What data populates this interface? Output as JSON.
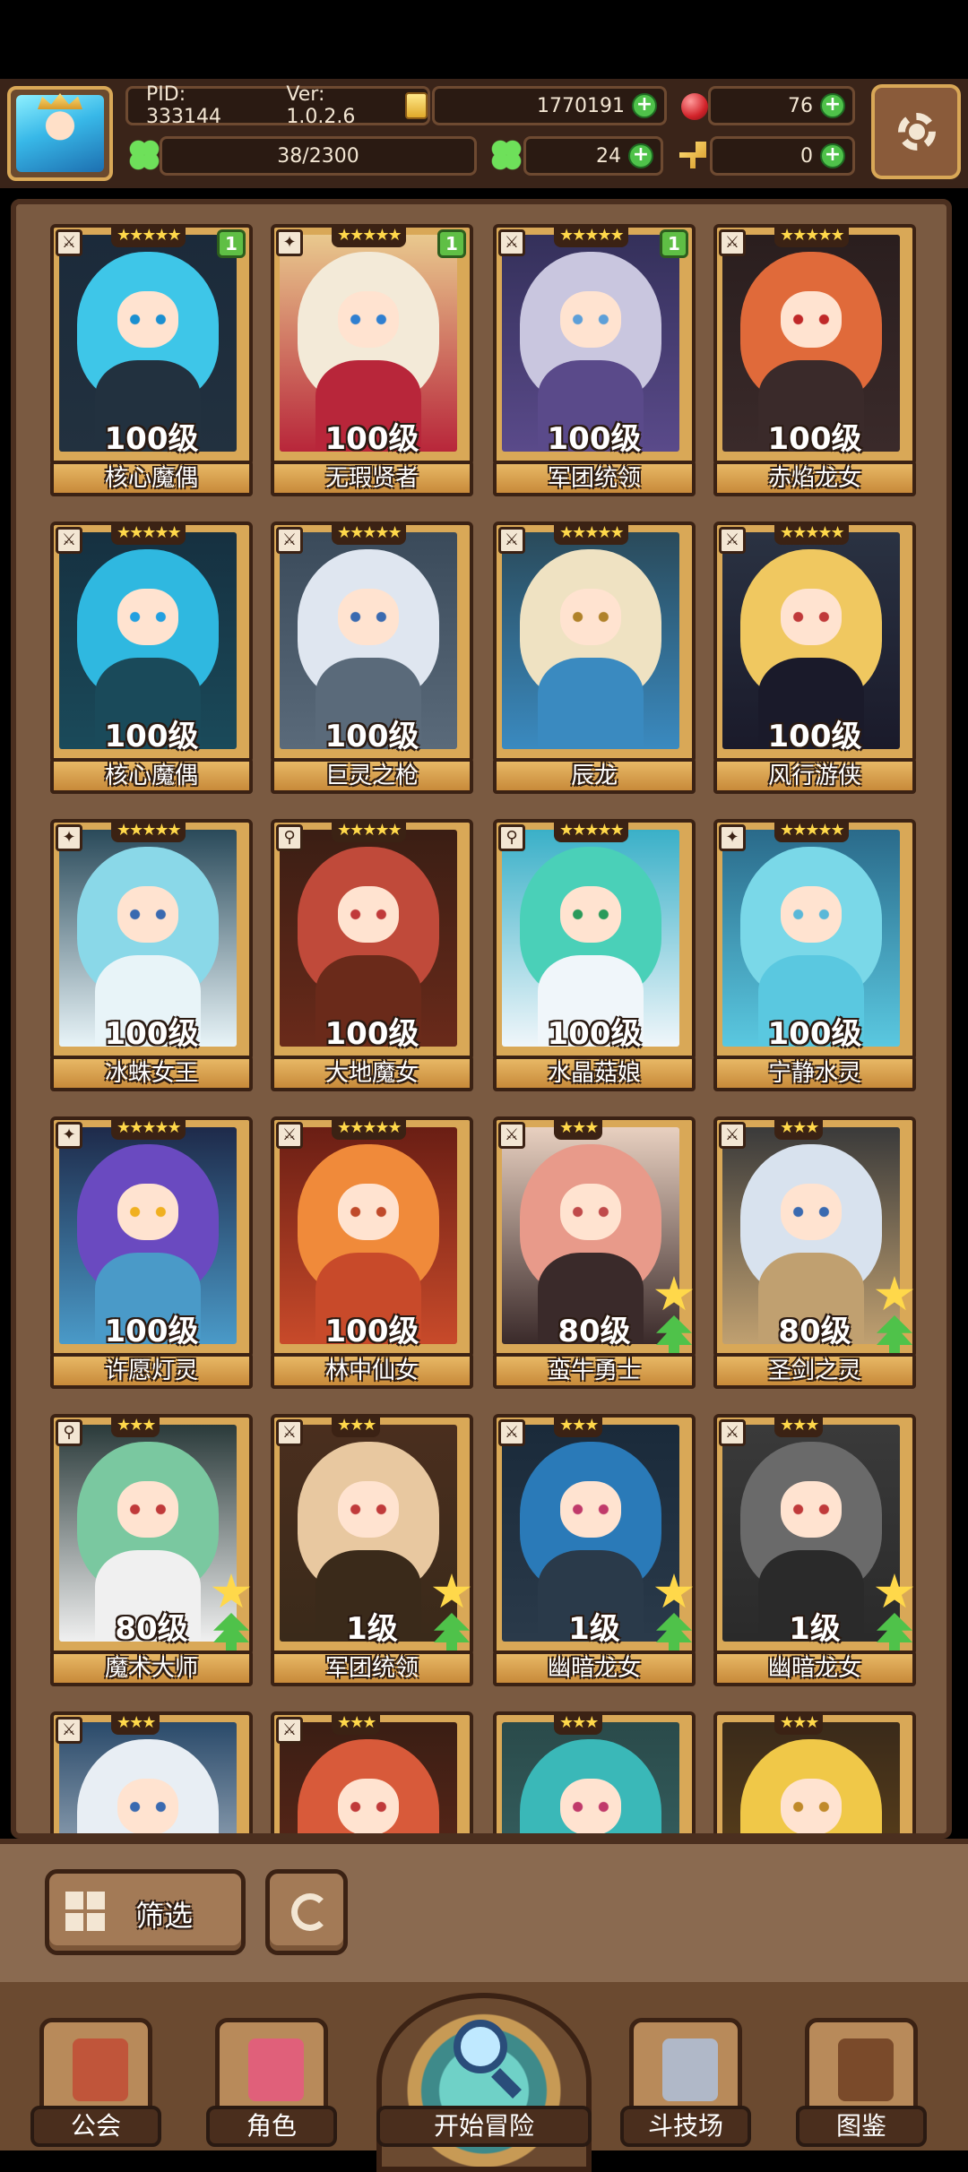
{
  "hud": {
    "pid": "PID: 333144",
    "version": "Ver: 1.0.2.6",
    "gold": "1770191",
    "gems": "76",
    "exp": "38/2300",
    "clover": "24",
    "keys": "0",
    "accent": "#d9a857"
  },
  "roster": [
    {
      "level": "100级",
      "name": "核心魔偶",
      "stars": "★★★★★",
      "class_icon": "⚔",
      "dupe": "1",
      "hair": "#3ec6e8",
      "eye": "#1a8fd0",
      "body": "#22313f",
      "bg": "#1b2a3a"
    },
    {
      "level": "100级",
      "name": "无瑕贤者",
      "stars": "★★★★★",
      "class_icon": "✦",
      "dupe": "1",
      "hair": "#f3ead8",
      "eye": "#2f7fd0",
      "body": "#b8263a",
      "bg": "#e9c98e"
    },
    {
      "level": "100级",
      "name": "军团统领",
      "stars": "★★★★★",
      "class_icon": "⚔",
      "dupe": "1",
      "hair": "#c9c6df",
      "eye": "#5d9fd8",
      "body": "#5a4a8a",
      "bg": "#34305a"
    },
    {
      "level": "100级",
      "name": "赤焰龙女",
      "stars": "★★★★★",
      "class_icon": "⚔",
      "dupe": "",
      "hair": "#e06a3a",
      "eye": "#c02828",
      "body": "#3a2a2a",
      "bg": "#2a1e1e"
    },
    {
      "level": "100级",
      "name": "核心魔偶",
      "stars": "★★★★★",
      "class_icon": "⚔",
      "dupe": "",
      "hair": "#2fb8e0",
      "eye": "#22a0e0",
      "body": "#1a4a5a",
      "bg": "#163040"
    },
    {
      "level": "100级",
      "name": "巨灵之枪",
      "stars": "★★★★★",
      "class_icon": "⚔",
      "dupe": "",
      "hair": "#dfe6f0",
      "eye": "#3a6ab0",
      "body": "#5a6a7a",
      "bg": "#3a4a5a"
    },
    {
      "level": "",
      "name": "辰龙",
      "stars": "★★★★★",
      "class_icon": "⚔",
      "dupe": "",
      "hair": "#efe2c2",
      "eye": "#b0822a",
      "body": "#3a8ac0",
      "bg": "#2a4a5a"
    },
    {
      "level": "100级",
      "name": "风行游侠",
      "stars": "★★★★★",
      "class_icon": "⚔",
      "dupe": "",
      "hair": "#f0c860",
      "eye": "#c03a3a",
      "body": "#1a1a2a",
      "bg": "#2a3242"
    },
    {
      "level": "100级",
      "name": "冰蛛女王",
      "stars": "★★★★★",
      "class_icon": "✦",
      "dupe": "",
      "hair": "#8ad8e8",
      "eye": "#3a6ab0",
      "body": "#e8f4f8",
      "bg": "#2a4a5a"
    },
    {
      "level": "100级",
      "name": "大地魔女",
      "stars": "★★★★★",
      "class_icon": "⚲",
      "dupe": "",
      "hair": "#c04a3a",
      "eye": "#c03a3a",
      "body": "#6a2a1a",
      "bg": "#3a1e14"
    },
    {
      "level": "100级",
      "name": "水晶菇娘",
      "stars": "★★★★★",
      "class_icon": "⚲",
      "dupe": "",
      "hair": "#4ad0b8",
      "eye": "#2a9a5a",
      "body": "#f0f6fa",
      "bg": "#3ab0c8"
    },
    {
      "level": "100级",
      "name": "宁静水灵",
      "stars": "★★★★★",
      "class_icon": "✦",
      "dupe": "",
      "hair": "#7ad8e8",
      "eye": "#5ab8d8",
      "body": "#5ac8e0",
      "bg": "#2a6a8a"
    },
    {
      "level": "100级",
      "name": "许愿灯灵",
      "stars": "★★★★★",
      "class_icon": "✦",
      "dupe": "",
      "hair": "#6a4ac0",
      "eye": "#f0b020",
      "body": "#4a9ac8",
      "bg": "#1e2a4a"
    },
    {
      "level": "100级",
      "name": "林中仙女",
      "stars": "★★★★★",
      "class_icon": "⚔",
      "dupe": "",
      "hair": "#f08a3a",
      "eye": "#c04a2a",
      "body": "#c84a2a",
      "bg": "#6a1e14"
    },
    {
      "level": "80级",
      "name": "蛮牛勇士",
      "stars": "★★★",
      "class_icon": "⚔",
      "dupe": "",
      "hair": "#e89a8a",
      "eye": "#c04a4a",
      "body": "#3a2a2a",
      "bg": "#e8d0c0",
      "promo": true
    },
    {
      "level": "80级",
      "name": "圣剑之灵",
      "stars": "★★★",
      "class_icon": "⚔",
      "dupe": "",
      "hair": "#d8e2ee",
      "eye": "#3a6ab0",
      "body": "#c0a070",
      "bg": "#3a3a3a",
      "promo": true
    },
    {
      "level": "80级",
      "name": "魔术大师",
      "stars": "★★★",
      "class_icon": "⚲",
      "dupe": "",
      "hair": "#7ac8a0",
      "eye": "#c03a3a",
      "body": "#f0f0f0",
      "bg": "#2a3a3a",
      "promo": true
    },
    {
      "level": "1级",
      "name": "军团统领",
      "stars": "★★★",
      "class_icon": "⚔",
      "dupe": "",
      "hair": "#e8c8a0",
      "eye": "#c03a3a",
      "body": "#3a2a1a",
      "bg": "#4a2e1e",
      "promo": true
    },
    {
      "level": "1级",
      "name": "幽暗龙女",
      "stars": "★★★",
      "class_icon": "⚔",
      "dupe": "",
      "hair": "#2a7ab8",
      "eye": "#c03a6a",
      "body": "#2a3a4a",
      "bg": "#1a2a3a",
      "promo": true
    },
    {
      "level": "1级",
      "name": "幽暗龙女",
      "stars": "★★★",
      "class_icon": "⚔",
      "dupe": "",
      "hair": "#6a6a6a",
      "eye": "#c03a3a",
      "body": "#2a2a2a",
      "bg": "#3a3a3a",
      "promo": true
    },
    {
      "level": "",
      "name": "",
      "stars": "★★★",
      "class_icon": "⚔",
      "dupe": "",
      "hair": "#e8eef4",
      "eye": "#3a6ab0",
      "body": "#d0d8e0",
      "bg": "#2a4a6a"
    },
    {
      "level": "",
      "name": "",
      "stars": "★★★",
      "class_icon": "⚔",
      "dupe": "",
      "hair": "#d85a3a",
      "eye": "#c03a3a",
      "body": "#6a2a1a",
      "bg": "#3a1e14"
    },
    {
      "level": "",
      "name": "",
      "stars": "★★★",
      "class_icon": "",
      "dupe": "",
      "hair": "#3ab8b8",
      "eye": "#c03a6a",
      "body": "#3a6a6a",
      "bg": "#2a4a4a"
    },
    {
      "level": "",
      "name": "",
      "stars": "★★★",
      "class_icon": "",
      "dupe": "",
      "hair": "#f0c848",
      "eye": "#c08a2a",
      "body": "#6a4a1a",
      "bg": "#3a2a1a"
    }
  ],
  "toolbar": {
    "filter_label": "筛选"
  },
  "nav": [
    {
      "label": "公会",
      "pic": "#c0553a"
    },
    {
      "label": "角色",
      "pic": "#e0607a"
    },
    {
      "label": "开始冒险"
    },
    {
      "label": "斗技场",
      "pic": "#b0b8c8"
    },
    {
      "label": "图鉴",
      "pic": "#7a4a2a"
    }
  ]
}
